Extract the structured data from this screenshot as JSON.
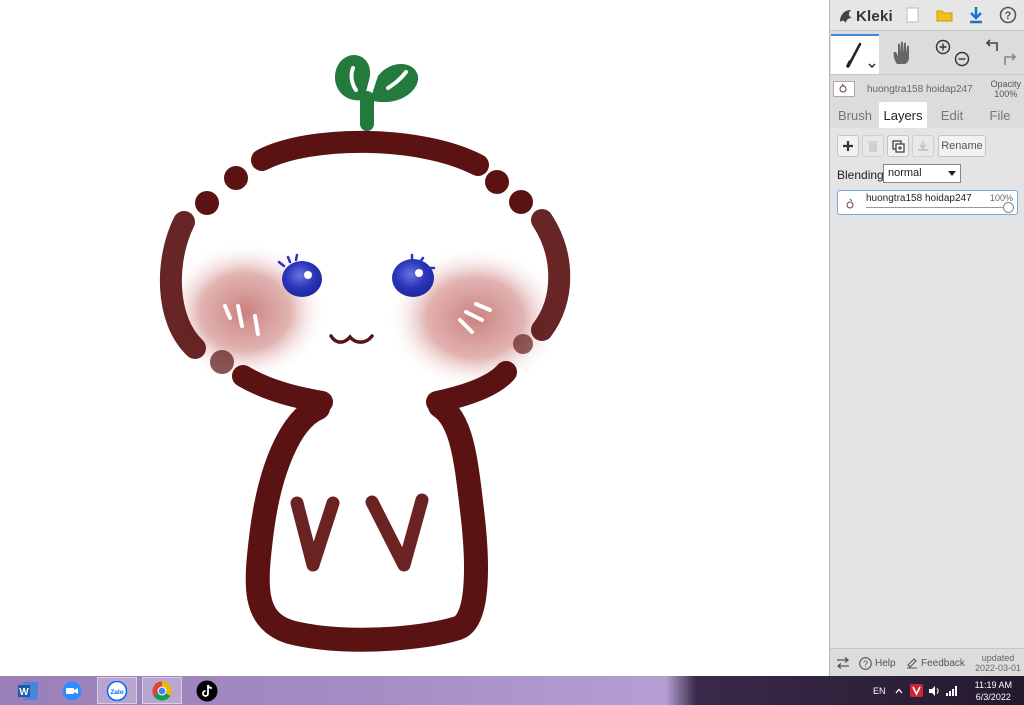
{
  "app": {
    "name": "Kleki"
  },
  "layer_bar": {
    "layer_name": "huongtra158 hoidap247",
    "opacity_label": "Opacity",
    "opacity_value": "100%"
  },
  "tabs": [
    {
      "label": "Brush",
      "active": false
    },
    {
      "label": "Layers",
      "active": true
    },
    {
      "label": "Edit",
      "active": false
    },
    {
      "label": "File",
      "active": false
    }
  ],
  "layers_panel": {
    "rename_label": "Rename",
    "blending_label": "Blending",
    "blending_value": "normal",
    "layers": [
      {
        "name": "huongtra158 hoidap247",
        "opacity": "100%"
      }
    ]
  },
  "footer": {
    "help_label": "Help",
    "feedback_label": "Feedback",
    "updated_label": "updated",
    "updated_date": "2022-03-01"
  },
  "taskbar": {
    "apps": [
      "word-icon",
      "zoom-icon",
      "zalo-icon",
      "chrome-icon",
      "tiktok-icon"
    ],
    "zalo_label": "Zalo",
    "language": "EN",
    "time": "11:19 AM",
    "date": "6/3/2022"
  },
  "colors": {
    "accent": "#3d88d8",
    "drawing_outline": "#5a1212",
    "sprout": "#237a3c",
    "eyes": "#2633b8",
    "blush": "#c97e7e"
  }
}
